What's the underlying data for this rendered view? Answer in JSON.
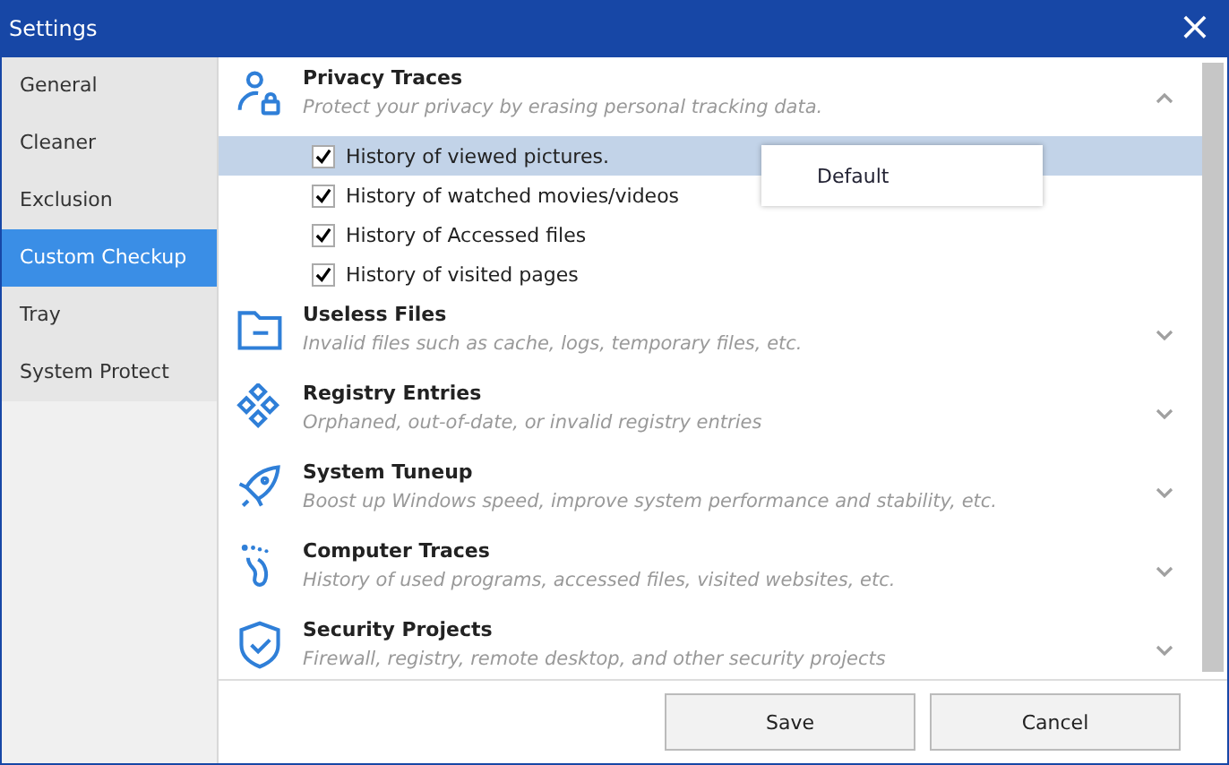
{
  "window": {
    "title": "Settings",
    "close": "×"
  },
  "sidebar": {
    "items": [
      {
        "label": "General",
        "selected": false
      },
      {
        "label": "Cleaner",
        "selected": false
      },
      {
        "label": "Exclusion",
        "selected": false
      },
      {
        "label": "Custom Checkup",
        "selected": true
      },
      {
        "label": "Tray",
        "selected": false
      },
      {
        "label": "System Protect",
        "selected": false
      }
    ]
  },
  "sections": [
    {
      "title": "Privacy Traces",
      "description": "Protect your privacy by erasing personal tracking data.",
      "expanded": true,
      "items": [
        {
          "label": "History of viewed pictures.",
          "checked": true,
          "selected": true
        },
        {
          "label": "History of watched movies/videos",
          "checked": true,
          "selected": false
        },
        {
          "label": "History of Accessed files",
          "checked": true,
          "selected": false
        },
        {
          "label": "History of visited pages",
          "checked": true,
          "selected": false
        }
      ]
    },
    {
      "title": "Useless Files",
      "description": "Invalid files such as cache, logs, temporary files, etc.",
      "expanded": false
    },
    {
      "title": "Registry Entries",
      "description": "Orphaned, out-of-date, or invalid registry entries",
      "expanded": false
    },
    {
      "title": "System Tuneup",
      "description": "Boost up Windows speed, improve system performance and stability, etc.",
      "expanded": false
    },
    {
      "title": "Computer Traces",
      "description": "History of used programs, accessed files, visited websites, etc.",
      "expanded": false
    },
    {
      "title": "Security Projects",
      "description": "Firewall, registry, remote desktop, and other security projects",
      "expanded": false
    }
  ],
  "context_menu": {
    "items": [
      "Default"
    ]
  },
  "buttons": [
    "Save",
    "Cancel"
  ]
}
